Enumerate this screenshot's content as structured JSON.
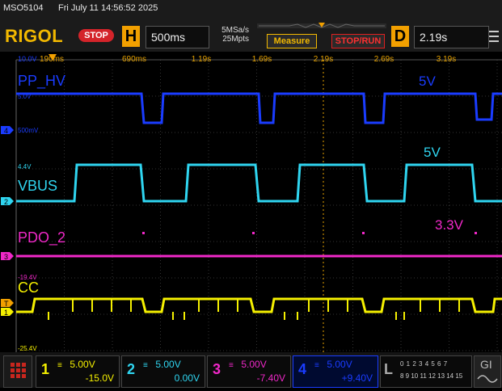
{
  "header": {
    "device": "MSO5104",
    "datetime": "Fri July 11 14:56:52 2025",
    "logo": "RIGOL",
    "run_state": "STOP",
    "horizontal_key": "H",
    "timebase": "500ms",
    "sample_rate": "5MSa/s",
    "memory_depth": "25Mpts",
    "measure_label": "Measure",
    "stoprun_label": "STOP/RUN",
    "delay_key": "D",
    "delay_value": "2.19s"
  },
  "time_axis": {
    "ticks": [
      "190ms",
      "690ms",
      "1.19s",
      "1.69s",
      "2.19s",
      "2.69s",
      "3.19s"
    ],
    "left_voltage": "10.0V"
  },
  "channels": [
    {
      "label": "PP_HV",
      "voltage": "5V",
      "color": "#1a3cff",
      "ref_high": "5.0V",
      "ref_low": "500mV"
    },
    {
      "label": "VBUS",
      "voltage": "5V",
      "color": "#2fd5f0",
      "ref_high": "4.4V"
    },
    {
      "label": "PDO_2",
      "voltage": "3.3V",
      "color": "#f028c8",
      "ref_low": "-19.4V"
    },
    {
      "label": "CC",
      "voltage": "",
      "color": "#f5f000",
      "ref_low": "-25.4V"
    }
  ],
  "channel_panel": [
    {
      "num": "1",
      "scale": "5.00V",
      "offset": "-15.0V",
      "color": "#f5f000"
    },
    {
      "num": "2",
      "scale": "5.00V",
      "offset": "0.00V",
      "color": "#2fd5f0"
    },
    {
      "num": "3",
      "scale": "5.00V",
      "offset": "-7.40V",
      "color": "#f028c8"
    },
    {
      "num": "4",
      "scale": "5.00V",
      "offset": "+9.40V",
      "color": "#1a3cff"
    }
  ],
  "digital": {
    "key": "L",
    "row1": "0 1 2 3 4 5 6 7",
    "row2": "8 9 10 11 12 13 14 15",
    "gi": "GI"
  }
}
